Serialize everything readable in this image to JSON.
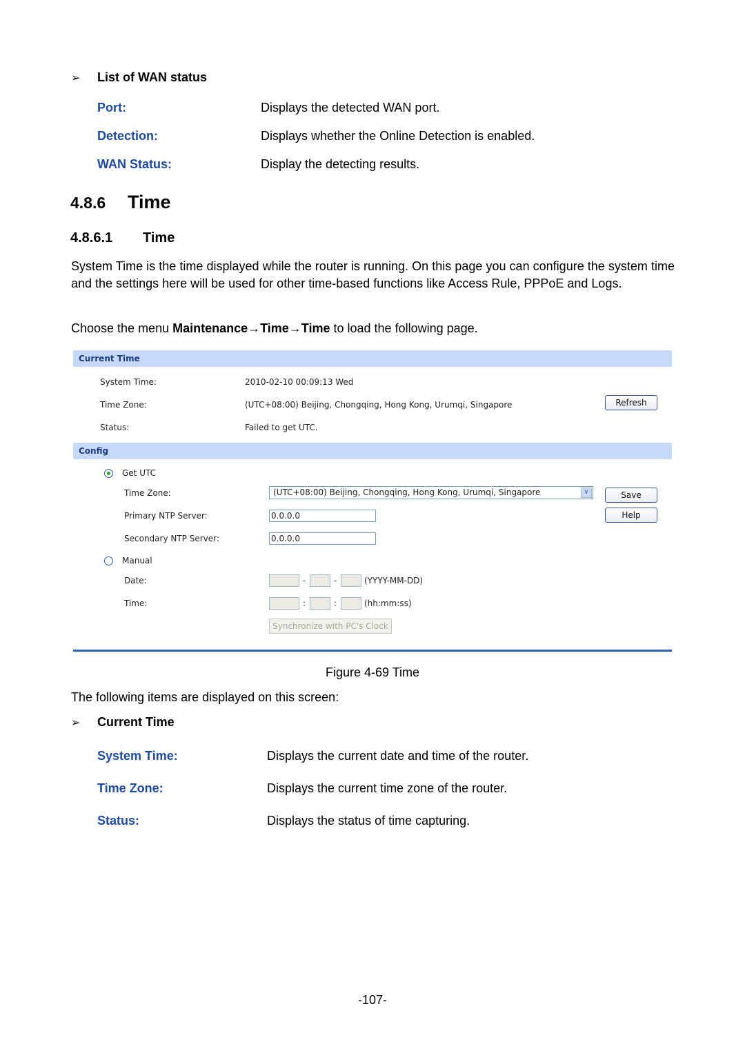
{
  "wan_status_list": {
    "heading": "List of WAN status",
    "bullet_icon": "arrow-bullet-icon",
    "items": [
      {
        "term": "Port:",
        "desc": "Displays the detected WAN port."
      },
      {
        "term": "Detection:",
        "desc": "Displays whether the Online Detection is enabled."
      },
      {
        "term": "WAN Status:",
        "desc": "Display the detecting results."
      }
    ]
  },
  "section": {
    "number": "4.8.6",
    "title": "Time"
  },
  "subsection": {
    "number": "4.8.6.1",
    "title": "Time"
  },
  "intro_paragraph": "System Time is the time displayed while the router is running. On this page you can configure the system time and the settings here will be used for other time-based functions like Access Rule, PPPoE and Logs.",
  "menu_instruction": {
    "prefix": "Choose the menu ",
    "path": "Maintenance→Time→Time",
    "suffix": " to load the following page."
  },
  "figure": {
    "current_time_header": "Current Time",
    "system_time_label": "System Time:",
    "system_time_value": "2010-02-10 00:09:13 Wed",
    "time_zone_label": "Time Zone:",
    "time_zone_value": "(UTC+08:00) Beijing, Chongqing, Hong Kong, Urumqi, Singapore",
    "status_label": "Status:",
    "status_value": "Failed to get UTC.",
    "refresh_button": "Refresh",
    "config_header": "Config",
    "get_utc_label": "Get UTC",
    "get_utc_selected": true,
    "config_time_zone_label": "Time Zone:",
    "config_time_zone_selected": "(UTC+08:00) Beijing, Chongqing, Hong Kong, Urumqi, Singapore",
    "primary_ntp_label": "Primary NTP Server:",
    "primary_ntp_value": "0.0.0.0",
    "secondary_ntp_label": "Secondary NTP Server:",
    "secondary_ntp_value": "0.0.0.0",
    "save_button": "Save",
    "help_button": "Help",
    "manual_label": "Manual",
    "manual_selected": false,
    "date_label": "Date:",
    "date_separator": "-",
    "date_format": "(YYYY-MM-DD)",
    "time_label": "Time:",
    "time_separator": ":",
    "time_format": "(hh:mm:ss)",
    "sync_button": "Synchronize with PC's Clock"
  },
  "figure_caption": "Figure 4-69 Time",
  "items_intro": "The following items are displayed on this screen:",
  "current_time_list": {
    "heading": "Current Time",
    "items": [
      {
        "term": "System Time:",
        "desc": "Displays the current date and time of the router."
      },
      {
        "term": "Time Zone:",
        "desc": "Displays the current time zone of the router."
      },
      {
        "term": "Status:",
        "desc": "Displays the status of time capturing."
      }
    ]
  },
  "page_number": "-107-"
}
